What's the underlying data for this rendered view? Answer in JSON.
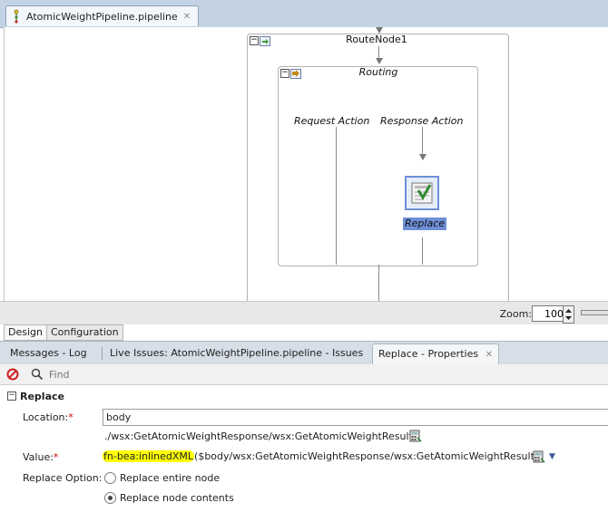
{
  "editor": {
    "tab_label": "AtomicWeightPipeline.pipeline",
    "close_glyph": "✕",
    "icon": "pipeline-file-icon"
  },
  "canvas": {
    "route_node": {
      "title": "RouteNode1",
      "collapse_glyph": "−"
    },
    "routing": {
      "title": "Routing",
      "collapse_glyph": "−"
    },
    "request_action": "Request Action",
    "response_action": "Response Action",
    "replace_action": {
      "label": "Replace",
      "icon": "replace-action-icon"
    }
  },
  "zoom": {
    "label": "Zoom:",
    "value": "100"
  },
  "design_tabs": [
    "Design",
    "Configuration"
  ],
  "bottom_tabs": [
    {
      "label": "Messages - Log"
    },
    {
      "label": "Live Issues: AtomicWeightPipeline.pipeline - Issues"
    },
    {
      "label": "Replace - Properties",
      "close_glyph": "✕"
    }
  ],
  "find": {
    "placeholder": "Find"
  },
  "properties": {
    "section_title": "Replace",
    "section_collapse_glyph": "−",
    "location_label": "Location:",
    "required_mark": "*",
    "location_value": "body",
    "xpath": "./wsx:GetAtomicWeightResponse/wsx:GetAtomicWeightResult",
    "value_label": "Value:",
    "value_highlight": "fn-bea:inlinedXML",
    "value_rest": "($body/wsx:GetAtomicWeightResponse/wsx:GetAtomicWeightResult)",
    "dropdown_glyph": "▼",
    "replace_option_label": "Replace Option:",
    "options": [
      {
        "label": "Replace entire node",
        "selected": false
      },
      {
        "label": "Replace node contents",
        "selected": true
      }
    ]
  },
  "colors": {
    "highlight": "#ffff00",
    "selected_label_bg": "#6f8fd8",
    "required": "#d00000"
  }
}
